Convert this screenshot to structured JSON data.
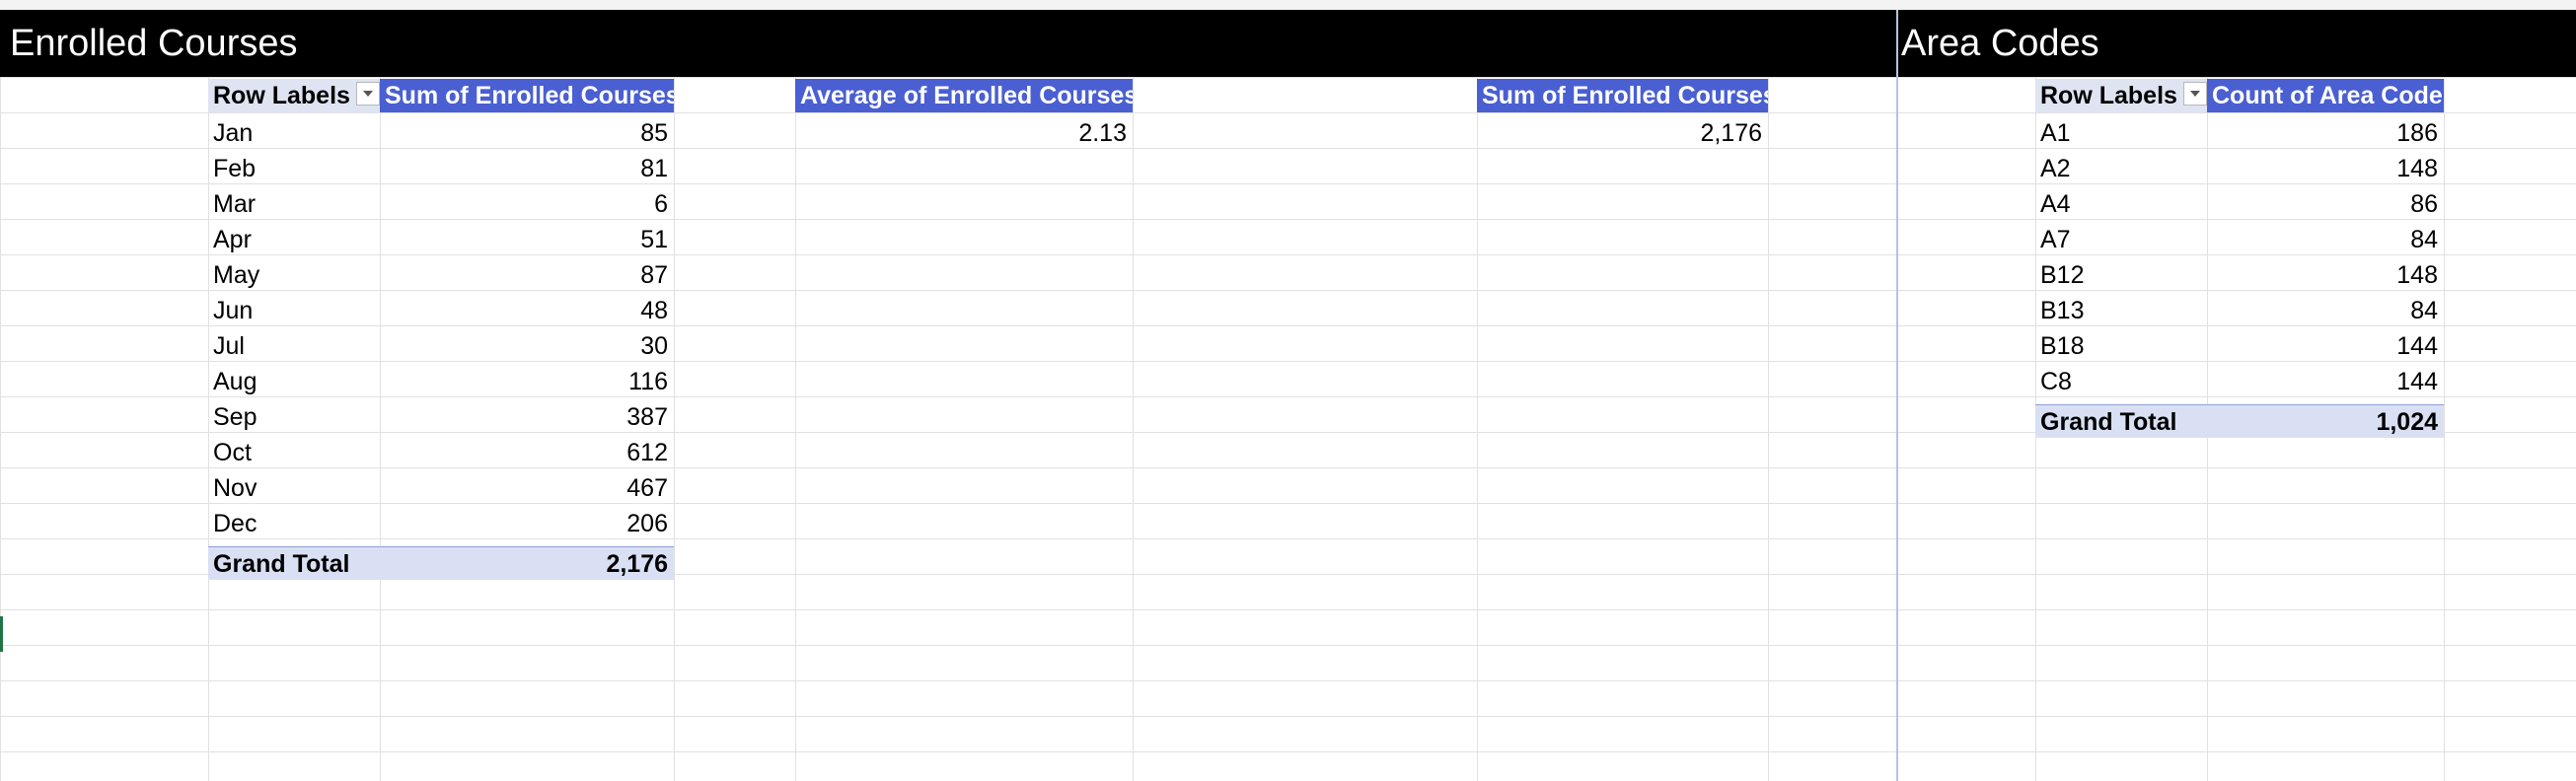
{
  "sections": {
    "enrolled_title": "Enrolled Courses",
    "area_title": "Area Codes"
  },
  "enrolled_pivot": {
    "row_header": "Row Labels",
    "value_header": "Sum of Enrolled Courses",
    "rows": [
      {
        "label": "Jan",
        "value": "85"
      },
      {
        "label": "Feb",
        "value": "81"
      },
      {
        "label": "Mar",
        "value": "6"
      },
      {
        "label": "Apr",
        "value": "51"
      },
      {
        "label": "May",
        "value": "87"
      },
      {
        "label": "Jun",
        "value": "48"
      },
      {
        "label": "Jul",
        "value": "30"
      },
      {
        "label": "Aug",
        "value": "116"
      },
      {
        "label": "Sep",
        "value": "387"
      },
      {
        "label": "Oct",
        "value": "612"
      },
      {
        "label": "Nov",
        "value": "467"
      },
      {
        "label": "Dec",
        "value": "206"
      }
    ],
    "grand_total_label": "Grand Total",
    "grand_total_value": "2,176"
  },
  "average_pivot": {
    "header": "Average of Enrolled Courses",
    "value": "2.13"
  },
  "sum_pivot": {
    "header": "Sum of Enrolled Courses",
    "value": "2,176"
  },
  "area_pivot": {
    "row_header": "Row Labels",
    "value_header": "Count of Area Code",
    "rows": [
      {
        "label": "A1",
        "value": "186"
      },
      {
        "label": "A2",
        "value": "148"
      },
      {
        "label": "A4",
        "value": "86"
      },
      {
        "label": "A7",
        "value": "84"
      },
      {
        "label": "B12",
        "value": "148"
      },
      {
        "label": "B13",
        "value": "84"
      },
      {
        "label": "B18",
        "value": "144"
      },
      {
        "label": "C8",
        "value": "144"
      }
    ],
    "grand_total_label": "Grand Total",
    "grand_total_value": "1,024"
  },
  "icons": {
    "filter_dropdown": "filter-dropdown-icon"
  }
}
